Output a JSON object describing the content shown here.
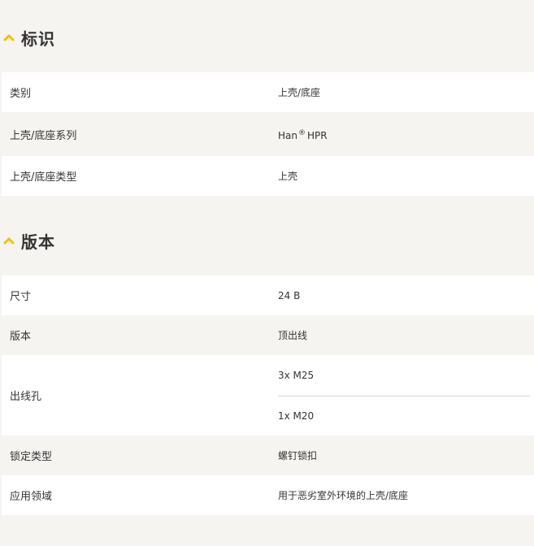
{
  "colors": {
    "accent": "#f2c200",
    "background": "#f5f4f1",
    "row_white": "#ffffff",
    "text": "#333333"
  },
  "identification": {
    "icon": "chevron-up-icon",
    "title": "标识",
    "rows": [
      {
        "label": "类别",
        "value": "上壳/底座"
      },
      {
        "label": "上壳/底座系列",
        "value_main": "Han",
        "value_sup": "®",
        "value_tail": "HPR"
      },
      {
        "label": "上壳/底座类型",
        "value": "上壳"
      }
    ]
  },
  "version": {
    "icon": "chevron-up-icon",
    "title": "版本",
    "rows": [
      {
        "label": "尺寸",
        "value": "24 B"
      },
      {
        "label": "版本",
        "value": "顶出线"
      },
      {
        "label": "出线孔",
        "values": [
          "3x M25",
          "1x M20"
        ]
      },
      {
        "label": "锁定类型",
        "value": "螺钉锁扣"
      },
      {
        "label": "应用领域",
        "value": "用于恶劣室外环境的上壳/底座"
      }
    ]
  }
}
